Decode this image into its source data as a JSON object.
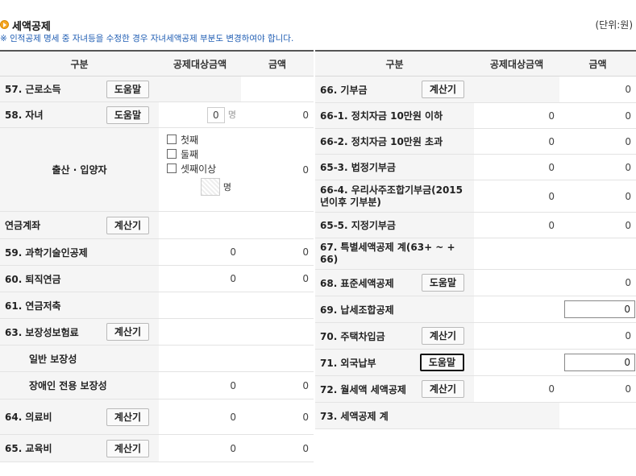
{
  "section": {
    "title": "세액공제",
    "unit": "(단위:원)",
    "note": "※ 인적공제 명세 중 자녀등을 수정한 경우 자녀세액공제 부분도 변경하여야 합니다."
  },
  "columns": {
    "category": "구분",
    "target": "공제대상금액",
    "amount": "금액"
  },
  "left": {
    "r57": {
      "label": "57. 근로소득",
      "button": "도움말"
    },
    "r58": {
      "label": "58. 자녀",
      "count": "0",
      "count_unit": "명",
      "amount": "0"
    },
    "birth": {
      "label": "출산 · 입양자",
      "options": [
        "첫째",
        "둘째",
        "셋째이상"
      ],
      "count_unit": "명",
      "amount": "0"
    },
    "pension": {
      "label": "연금계좌",
      "button": "계산기"
    },
    "r59": {
      "label": "59. 과학기술인공제",
      "target": "0",
      "amount": "0"
    },
    "r60": {
      "label": "60. 퇴직연금",
      "target": "0",
      "amount": "0"
    },
    "r61": {
      "label": "61. 연금저축"
    },
    "r63": {
      "label": "63. 보장성보험료",
      "button": "계산기"
    },
    "general": {
      "label": "일반 보장성"
    },
    "disabled": {
      "label": "장애인 전용 보장성",
      "target": "0",
      "amount": "0"
    },
    "r64": {
      "label": "64. 의료비",
      "button": "계산기",
      "target": "0",
      "amount": "0"
    },
    "r65": {
      "label": "65. 교육비",
      "button": "계산기",
      "target": "0",
      "amount": "0"
    }
  },
  "right": {
    "r66": {
      "label": "66. 기부금",
      "button": "계산기",
      "amount": "0"
    },
    "r66_1": {
      "label": "66-1. 정치자금 10만원 이하",
      "target": "0",
      "amount": "0"
    },
    "r66_2": {
      "label": "66-2. 정치자금 10만원 초과",
      "target": "0",
      "amount": "0"
    },
    "r65_3": {
      "label": "65-3. 법정기부금",
      "target": "0",
      "amount": "0"
    },
    "r66_4": {
      "label": "66-4. 우리사주조합기부금(2015년이후 기부분)",
      "target": "0",
      "amount": "0"
    },
    "r65_5": {
      "label": "65-5. 지정기부금",
      "target": "0",
      "amount": "0"
    },
    "r67": {
      "label": "67. 특별세액공제 계(63+ ~ + 66)"
    },
    "r68": {
      "label": "68. 표준세액공제",
      "button": "도움말",
      "amount": "0"
    },
    "r69": {
      "label": "69. 납세조합공제",
      "amount": "0"
    },
    "r70": {
      "label": "70. 주택차입금",
      "button": "계산기",
      "amount": "0"
    },
    "r71": {
      "label": "71. 외국납부",
      "button": "도움말",
      "amount": "0"
    },
    "r72": {
      "label": "72. 월세액 세액공제",
      "button": "계산기",
      "target": "0",
      "amount": "0"
    },
    "r73": {
      "label": "73. 세액공제 계"
    }
  }
}
